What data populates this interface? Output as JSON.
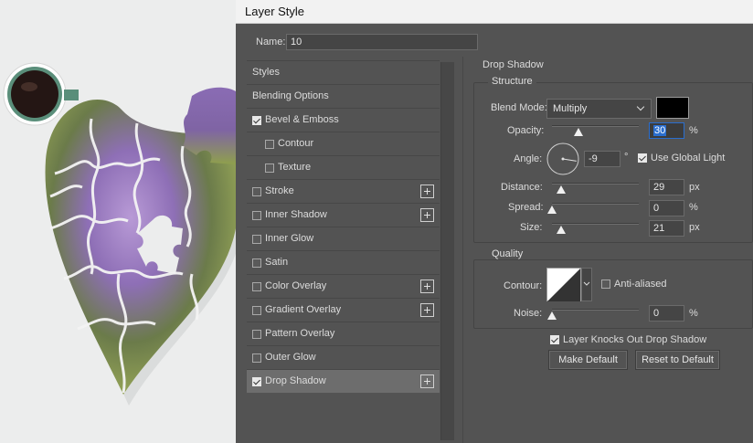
{
  "dialog": {
    "title": "Layer Style"
  },
  "name_field": {
    "label": "Name:",
    "value": "10"
  },
  "style_list": {
    "items": [
      {
        "label": "Styles",
        "checkbox": false,
        "checked": false,
        "plus": false,
        "indent": 0,
        "selected": false
      },
      {
        "label": "Blending Options",
        "checkbox": false,
        "checked": false,
        "plus": false,
        "indent": 0,
        "selected": false
      },
      {
        "label": "Bevel & Emboss",
        "checkbox": true,
        "checked": true,
        "plus": false,
        "indent": 0,
        "selected": false
      },
      {
        "label": "Contour",
        "checkbox": true,
        "checked": false,
        "plus": false,
        "indent": 1,
        "selected": false
      },
      {
        "label": "Texture",
        "checkbox": true,
        "checked": false,
        "plus": false,
        "indent": 1,
        "selected": false
      },
      {
        "label": "Stroke",
        "checkbox": true,
        "checked": false,
        "plus": true,
        "indent": 0,
        "selected": false
      },
      {
        "label": "Inner Shadow",
        "checkbox": true,
        "checked": false,
        "plus": true,
        "indent": 0,
        "selected": false
      },
      {
        "label": "Inner Glow",
        "checkbox": true,
        "checked": false,
        "plus": false,
        "indent": 0,
        "selected": false
      },
      {
        "label": "Satin",
        "checkbox": true,
        "checked": false,
        "plus": false,
        "indent": 0,
        "selected": false
      },
      {
        "label": "Color Overlay",
        "checkbox": true,
        "checked": false,
        "plus": true,
        "indent": 0,
        "selected": false
      },
      {
        "label": "Gradient Overlay",
        "checkbox": true,
        "checked": false,
        "plus": true,
        "indent": 0,
        "selected": false
      },
      {
        "label": "Pattern Overlay",
        "checkbox": true,
        "checked": false,
        "plus": false,
        "indent": 0,
        "selected": false
      },
      {
        "label": "Outer Glow",
        "checkbox": true,
        "checked": false,
        "plus": false,
        "indent": 0,
        "selected": false
      },
      {
        "label": "Drop Shadow",
        "checkbox": true,
        "checked": true,
        "plus": true,
        "indent": 0,
        "selected": true
      }
    ]
  },
  "drop_shadow": {
    "section_title": "Drop Shadow",
    "structure": {
      "title": "Structure",
      "blend_mode": {
        "label": "Blend Mode:",
        "value": "Multiply",
        "color": "#000000"
      },
      "opacity": {
        "label": "Opacity:",
        "value": "30",
        "unit": "%",
        "level": 0.3
      },
      "angle": {
        "label": "Angle:",
        "value": "-9",
        "unit": "°",
        "degrees": -9
      },
      "use_global_light": {
        "label": "Use Global Light",
        "checked": true
      },
      "distance": {
        "label": "Distance:",
        "value": "29",
        "unit": "px",
        "level": 0.1
      },
      "spread": {
        "label": "Spread:",
        "value": "0",
        "unit": "%",
        "level": 0
      },
      "size": {
        "label": "Size:",
        "value": "21",
        "unit": "px",
        "level": 0.1
      }
    },
    "quality": {
      "title": "Quality",
      "contour": {
        "label": "Contour:"
      },
      "anti_aliased": {
        "label": "Anti-aliased",
        "checked": false
      },
      "noise": {
        "label": "Noise:",
        "value": "0",
        "unit": "%",
        "level": 0
      }
    },
    "layer_knocks_out": {
      "label": "Layer Knocks Out Drop Shadow",
      "checked": true
    },
    "make_default": "Make Default",
    "reset_to_default": "Reset to Default"
  },
  "colors": {
    "dialog_bg": "#535353",
    "selected_row": "#6d6d6d",
    "field_bg": "#454545",
    "focus": "#2a6ecf"
  }
}
